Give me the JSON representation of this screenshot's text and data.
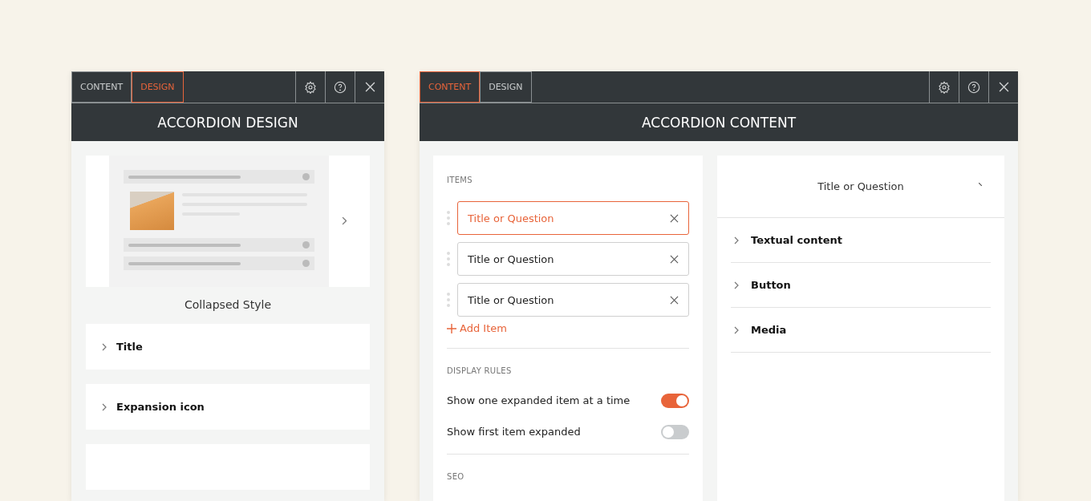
{
  "design_panel": {
    "tabs": [
      {
        "label": "CONTENT",
        "selected": false
      },
      {
        "label": "DESIGN",
        "selected": true
      }
    ],
    "title": "ACCORDION DESIGN",
    "style_caption": "Collapsed Style",
    "sections": [
      {
        "label": "Title"
      },
      {
        "label": "Expansion icon"
      }
    ]
  },
  "content_panel": {
    "tabs": [
      {
        "label": "CONTENT",
        "selected": true
      },
      {
        "label": "DESIGN",
        "selected": false
      }
    ],
    "title": "ACCORDION CONTENT",
    "items_label": "ITEMS",
    "items": [
      {
        "value": "Title or Question",
        "selected": true
      },
      {
        "value": "Title or Question",
        "selected": false
      },
      {
        "value": "Title or Question",
        "selected": false
      }
    ],
    "add_item": "Add Item",
    "display_rules_label": "DISPLAY RULES",
    "rules": [
      {
        "label": "Show one expanded item at a time",
        "on": true
      },
      {
        "label": "Show first item expanded",
        "on": false
      }
    ],
    "seo_label": "SEO",
    "preview": {
      "title": "Title or Question",
      "sections": [
        {
          "label": "Textual content"
        },
        {
          "label": "Button"
        },
        {
          "label": "Media"
        }
      ]
    }
  }
}
